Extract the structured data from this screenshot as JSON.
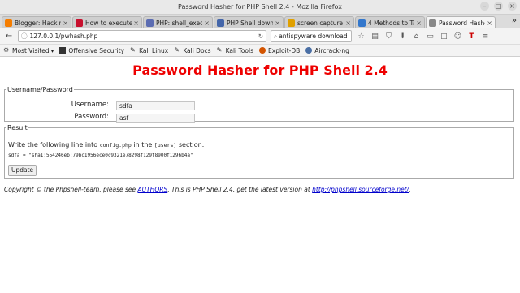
{
  "window": {
    "title": "Password Hasher for PHP Shell 2.4 - Mozilla Firefox"
  },
  "tabs": [
    {
      "label": "Blogger: Hackin...",
      "icon": "blogger-icon",
      "color": "#f57d00",
      "active": false
    },
    {
      "label": "How to execute...",
      "icon": "page-icon",
      "color": "#c8102e",
      "active": false
    },
    {
      "label": "PHP: shell_exec...",
      "icon": "php-icon",
      "color": "#5b6cb2",
      "active": false
    },
    {
      "label": "PHP Shell down...",
      "icon": "page-icon",
      "color": "#4466aa",
      "active": false
    },
    {
      "label": "screen capture f...",
      "icon": "spyware-icon",
      "color": "#e0a000",
      "active": false
    },
    {
      "label": "4 Methods to Ta...",
      "icon": "page-icon",
      "color": "#3377cc",
      "active": false
    },
    {
      "label": "Password Hashe...",
      "icon": "page-icon",
      "color": "#888888",
      "active": true
    }
  ],
  "navbar": {
    "url": "127.0.0.1/pwhash.php",
    "search_value": "antispyware download"
  },
  "bookmarks": [
    {
      "label": "Most Visited",
      "icon": "gear-icon",
      "dropdown": true
    },
    {
      "label": "Offensive Security",
      "icon": "offsec-icon"
    },
    {
      "label": "Kali Linux",
      "icon": "kali-icon"
    },
    {
      "label": "Kali Docs",
      "icon": "kali-icon"
    },
    {
      "label": "Kali Tools",
      "icon": "kali-icon"
    },
    {
      "label": "Exploit-DB",
      "icon": "exploitdb-icon"
    },
    {
      "label": "Aircrack-ng",
      "icon": "aircrack-icon"
    }
  ],
  "page": {
    "heading": "Password Hasher for PHP Shell 2.4",
    "credentials": {
      "legend": "Username/Password",
      "username_label": "Username:",
      "username_value": "sdfa",
      "password_label": "Password:",
      "password_value": "asf"
    },
    "result": {
      "legend": "Result",
      "text_before": "Write the following line into ",
      "config_file": "config.php",
      "text_middle": " in the ",
      "section_name": "[users]",
      "text_after": " section:",
      "hash_line": "sdfa = \"sha1:554246eb:79bc1956ece0c9321e78298f129f8900f1296b4a\"",
      "update_label": "Update"
    },
    "footer": {
      "text1": "Copyright © the Phpshell-team, please see ",
      "authors_link": "AUTHORS",
      "text2": ". This is PHP Shell 2.4, get the latest version at ",
      "site_link": "http://phpshell.sourceforge.net/",
      "text3": "."
    }
  },
  "colors": {
    "heading": "#ee0000",
    "link": "#0000cc"
  }
}
